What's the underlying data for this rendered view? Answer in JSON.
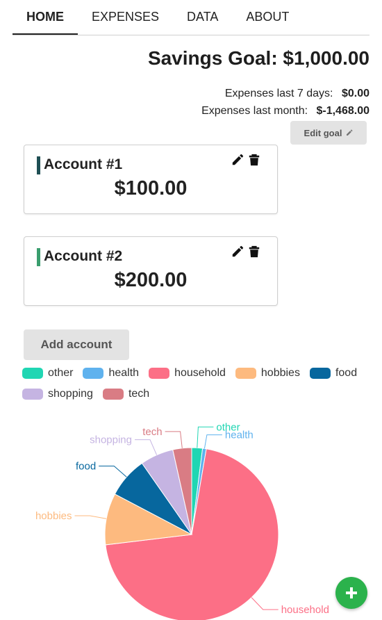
{
  "nav": {
    "tabs": [
      "HOME",
      "EXPENSES",
      "DATA",
      "ABOUT"
    ],
    "active": 0
  },
  "goal": {
    "title": "Savings Goal: $1,000.00",
    "exp7_label": "Expenses last 7 days:",
    "exp7_value": "$0.00",
    "expMonth_label": "Expenses last month:",
    "expMonth_value": "$-1,468.00",
    "edit_label": "Edit goal",
    "edit_icon": "pencil-icon"
  },
  "accounts": [
    {
      "name": "Account #1",
      "amount": "$100.00",
      "color": "#1f4f54"
    },
    {
      "name": "Account #2",
      "amount": "$200.00",
      "color": "#3a9e6e"
    }
  ],
  "add_account_label": "Add account",
  "fab_icon": "plus-icon",
  "chart_data": {
    "type": "pie",
    "categories": [
      "other",
      "health",
      "household",
      "hobbies",
      "food",
      "shopping",
      "tech"
    ],
    "colors": [
      "#20d6b3",
      "#5fb2ee",
      "#fc6f86",
      "#fdba7f",
      "#07679e",
      "#c5b4e2",
      "#d97c84"
    ],
    "values": [
      2.0,
      0.7,
      70.4,
      9.6,
      7.6,
      6.2,
      3.5
    ],
    "legend_position": "top"
  }
}
